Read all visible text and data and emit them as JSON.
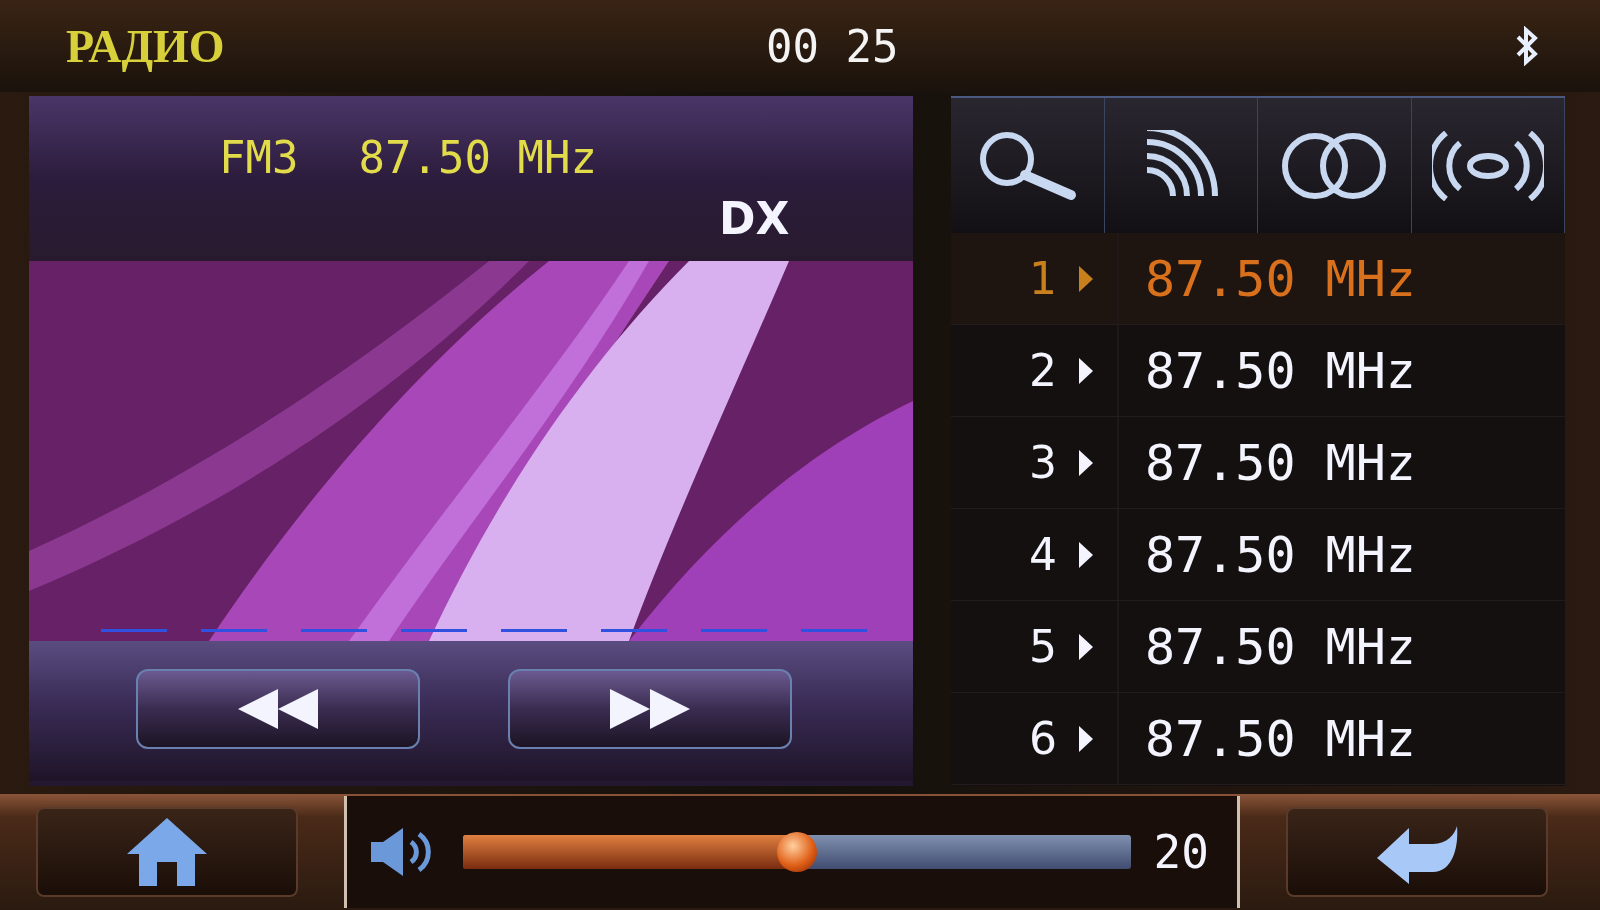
{
  "header": {
    "title": "РАДИО",
    "clock": "00 25"
  },
  "tuner": {
    "band": "FM3",
    "frequency": "87.50 MHz",
    "dx": "DX"
  },
  "presets": [
    {
      "number": "1",
      "frequency": "87.50 MHz",
      "selected": true
    },
    {
      "number": "2",
      "frequency": "87.50 MHz",
      "selected": false
    },
    {
      "number": "3",
      "frequency": "87.50 MHz",
      "selected": false
    },
    {
      "number": "4",
      "frequency": "87.50 MHz",
      "selected": false
    },
    {
      "number": "5",
      "frequency": "87.50 MHz",
      "selected": false
    },
    {
      "number": "6",
      "frequency": "87.50 MHz",
      "selected": false
    }
  ],
  "volume": {
    "level": 0.5,
    "reading": "20"
  }
}
